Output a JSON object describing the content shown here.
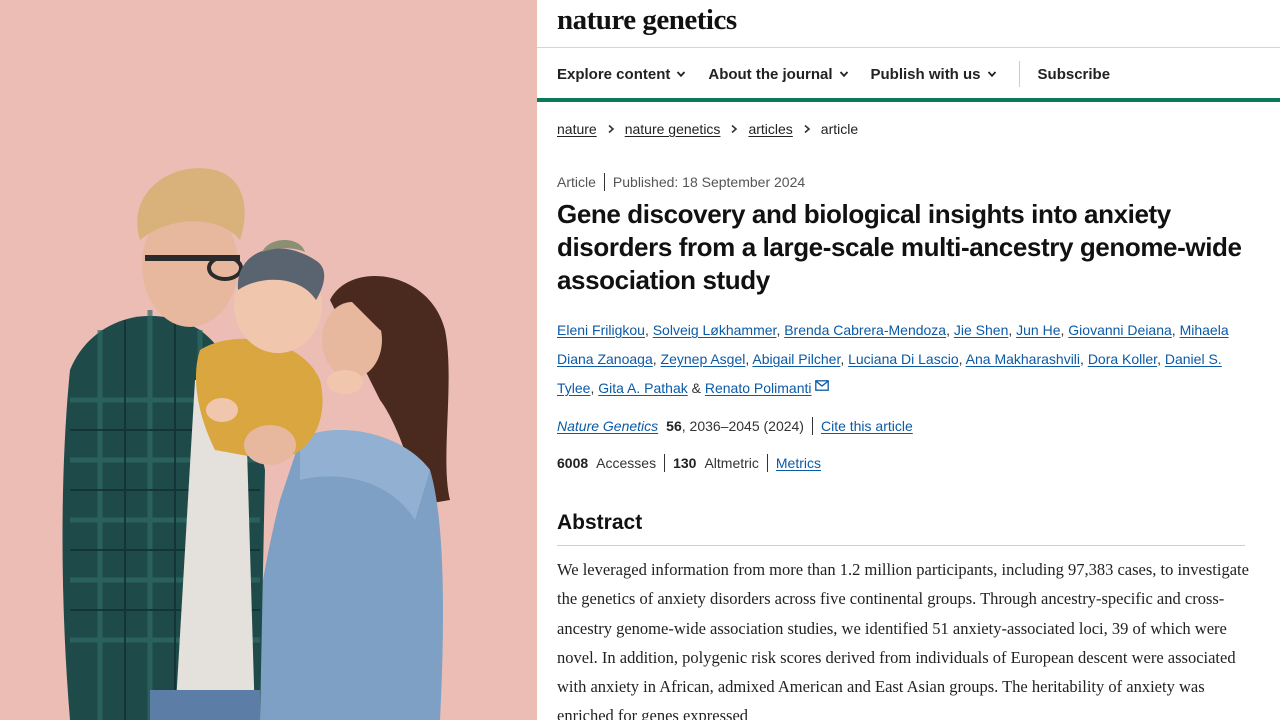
{
  "photo": {
    "description_icon": "family-photo",
    "background_color": "#e6b3ac"
  },
  "header": {
    "brand": "nature genetics",
    "nav": [
      {
        "label": "Explore content",
        "has_dropdown": true
      },
      {
        "label": "About the journal",
        "has_dropdown": true
      },
      {
        "label": "Publish with us",
        "has_dropdown": true
      },
      {
        "label": "Subscribe",
        "has_dropdown": false
      }
    ],
    "accent_color": "#0a7a5e"
  },
  "breadcrumb": [
    "nature",
    "nature genetics",
    "articles",
    "article"
  ],
  "article": {
    "type": "Article",
    "published": "Published: 18 September 2024",
    "title": "Gene discovery and biological insights into anxiety disorders from a large-scale multi-ancestry genome-wide association study",
    "authors": [
      "Eleni Friligkou",
      "Solveig Løkhammer",
      "Brenda Cabrera-Mendoza",
      "Jie Shen",
      "Jun He",
      "Giovanni Deiana",
      "Mihaela Diana Zanoaga",
      "Zeynep Asgel",
      "Abigail Pilcher",
      "Luciana Di Lascio",
      "Ana Makharashvili",
      "Dora Koller",
      "Daniel S. Tylee",
      "Gita A. Pathak",
      "Renato Polimanti"
    ],
    "author_separator": ", ",
    "author_and": " & ",
    "citation": {
      "journal": "Nature Genetics",
      "volume": "56",
      "pages_year": ", 2036–2045 (2024)",
      "cite_label": "Cite this article"
    },
    "metrics": {
      "accesses_value": "6008",
      "accesses_label": "Accesses",
      "altmetric_value": "130",
      "altmetric_label": "Altmetric",
      "metrics_link": "Metrics"
    },
    "abstract_heading": "Abstract",
    "abstract_text": "We leveraged information from more than 1.2 million participants, including 97,383 cases, to investigate the genetics of anxiety disorders across five continental groups. Through ancestry-specific and cross-ancestry genome-wide association studies, we identified 51 anxiety-associated loci, 39 of which were novel. In addition, polygenic risk scores derived from individuals of European descent were associated with anxiety in African, admixed American and East Asian groups. The heritability of anxiety was enriched for genes expressed"
  }
}
